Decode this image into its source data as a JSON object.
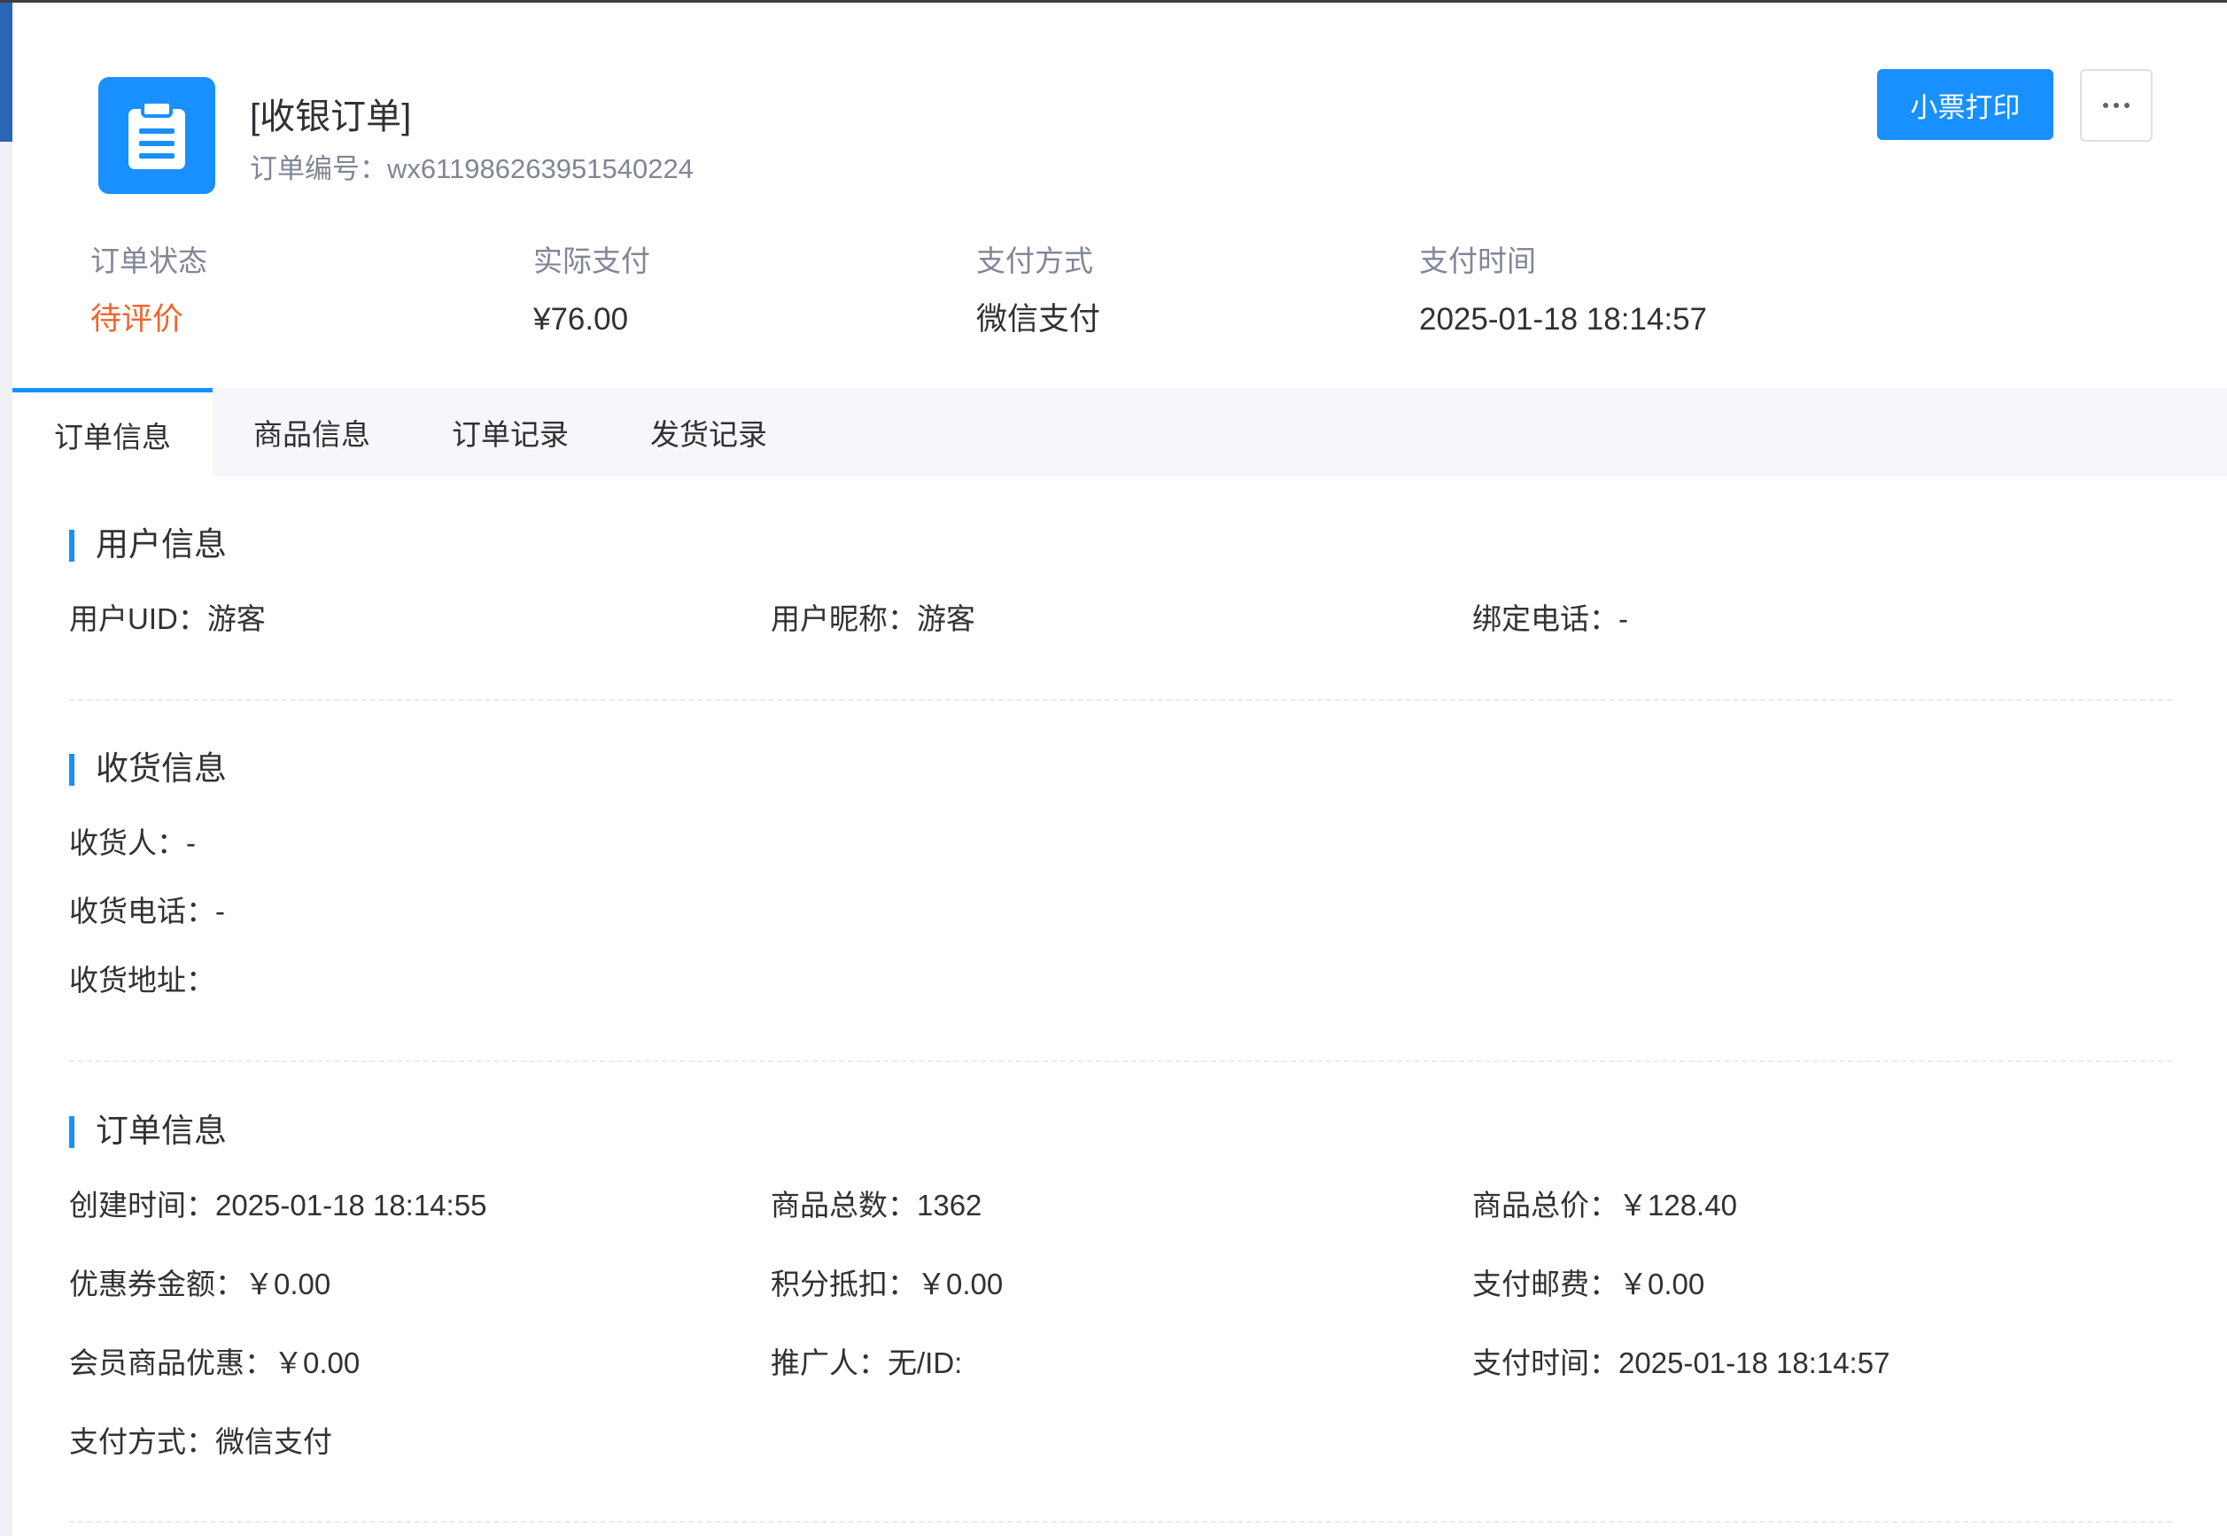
{
  "header": {
    "title": "[收银订单]",
    "order_no_label": "订单编号：",
    "order_no": "wx611986263951540224",
    "print_button": "小票打印",
    "more_button": "···"
  },
  "summary": [
    {
      "label": "订单状态",
      "value": "待评价"
    },
    {
      "label": "实际支付",
      "value": "¥76.00"
    },
    {
      "label": "支付方式",
      "value": "微信支付"
    },
    {
      "label": "支付时间",
      "value": "2025-01-18 18:14:57"
    }
  ],
  "tabs": [
    {
      "label": "订单信息",
      "active": true
    },
    {
      "label": "商品信息",
      "active": false
    },
    {
      "label": "订单记录",
      "active": false
    },
    {
      "label": "发货记录",
      "active": false
    }
  ],
  "user_info": {
    "title": "用户信息",
    "uid": "用户UID：游客",
    "nickname": "用户昵称：游客",
    "phone": "绑定电话：-"
  },
  "shipping_info": {
    "title": "收货信息",
    "receiver": "收货人：-",
    "phone": "收货电话：-",
    "address": "收货地址："
  },
  "order_info": {
    "title": "订单信息",
    "create_time": "创建时间：2025-01-18 18:14:55",
    "goods_count": "商品总数：1362",
    "goods_total": "商品总价：￥128.40",
    "coupon": "优惠券金额：￥0.00",
    "points": "积分抵扣：￥0.00",
    "postage": "支付邮费：￥0.00",
    "member_discount": "会员商品优惠：￥0.00",
    "promoter": "推广人：无/ID:",
    "pay_time": "支付时间：2025-01-18 18:14:57",
    "pay_method": "支付方式：微信支付"
  },
  "colors": {
    "primary": "#1890ff",
    "status": "#f0652d",
    "label_gray": "#808695"
  },
  "icons": {
    "logo": "clipboard-icon",
    "more": "ellipsis-icon"
  }
}
